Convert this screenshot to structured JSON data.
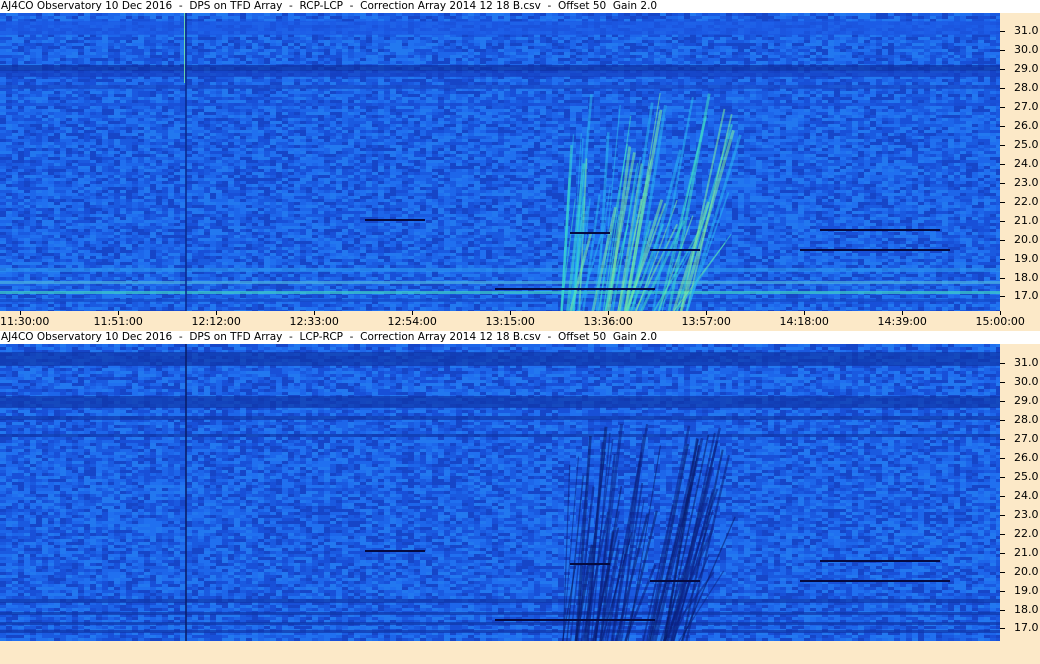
{
  "chart_data": [
    {
      "type": "heatmap",
      "title": "AJ4CO Observatory 10 Dec 2016  -  DPS on TFD Array  -  RCP-LCP  -  Correction Array 2014 12 18 B.csv  -  Offset 50  Gain 2.0",
      "ylabel": "",
      "xlabel": "",
      "y_ticks": [
        "31.0",
        "30.0",
        "29.0",
        "28.0",
        "27.0",
        "26.0",
        "25.0",
        "24.0",
        "23.0",
        "22.0",
        "21.0",
        "20.0",
        "19.0",
        "18.0",
        "17.0"
      ],
      "x_ticks": [
        "11:30:00",
        "11:51:00",
        "12:12:00",
        "12:33:00",
        "12:54:00",
        "13:15:00",
        "13:36:00",
        "13:57:00",
        "14:18:00",
        "14:39:00",
        "15:00:00"
      ],
      "ylim": [
        16.5,
        31.7
      ],
      "xlim": [
        "11:30:00",
        "15:00:00"
      ],
      "colormap": [
        "#0a1e8c",
        "#1646d6",
        "#1f6ff0",
        "#2aa8f0",
        "#3fe0c8",
        "#c8f060"
      ]
    },
    {
      "type": "heatmap",
      "title": "AJ4CO Observatory 10 Dec 2016  -  DPS on TFD Array  -  LCP-RCP  -  Correction Array 2014 12 18 B.csv  -  Offset 50  Gain 2.0",
      "ylabel": "",
      "xlabel": "",
      "y_ticks": [
        "31.0",
        "30.0",
        "29.0",
        "28.0",
        "27.0",
        "26.0",
        "25.0",
        "24.0",
        "23.0",
        "22.0",
        "21.0",
        "20.0",
        "19.0",
        "18.0",
        "17.0"
      ],
      "x_ticks": [],
      "ylim": [
        16.5,
        31.7
      ],
      "xlim": [
        "11:30:00",
        "15:00:00"
      ],
      "colormap": [
        "#0a1e8c",
        "#1646d6",
        "#1f6ff0",
        "#2aa8f0",
        "#3fe0c8",
        "#c8f060"
      ]
    }
  ]
}
